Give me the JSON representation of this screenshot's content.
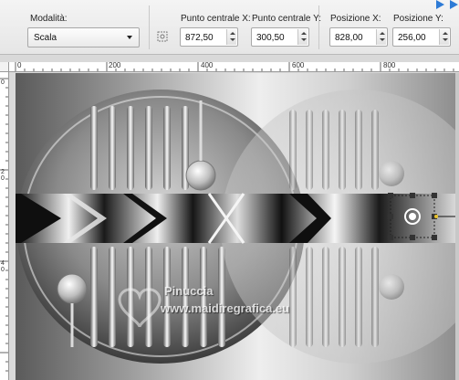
{
  "toolbar": {
    "mode": {
      "label": "Modalità:",
      "value": "Scala"
    },
    "center_x": {
      "label": "Punto centrale X:",
      "value": "872,50"
    },
    "center_y": {
      "label": "Punto centrale Y:",
      "value": "300,50"
    },
    "pos_x": {
      "label": "Posizione X:",
      "value": "828,00"
    },
    "pos_y": {
      "label": "Posizione Y:",
      "value": "256,00"
    }
  },
  "ruler": {
    "h_labels": [
      "0",
      "200",
      "400",
      "600",
      "800"
    ],
    "v_labels": [
      "0",
      "2\n0",
      "4\n0"
    ]
  },
  "watermark": {
    "name": "Pinuccia",
    "url": "www.maidiregrafica.eu"
  },
  "colors": {
    "toolbar_bg": "#ececec",
    "canvas_bg": "#d9d9d9",
    "selection": "#333333"
  }
}
